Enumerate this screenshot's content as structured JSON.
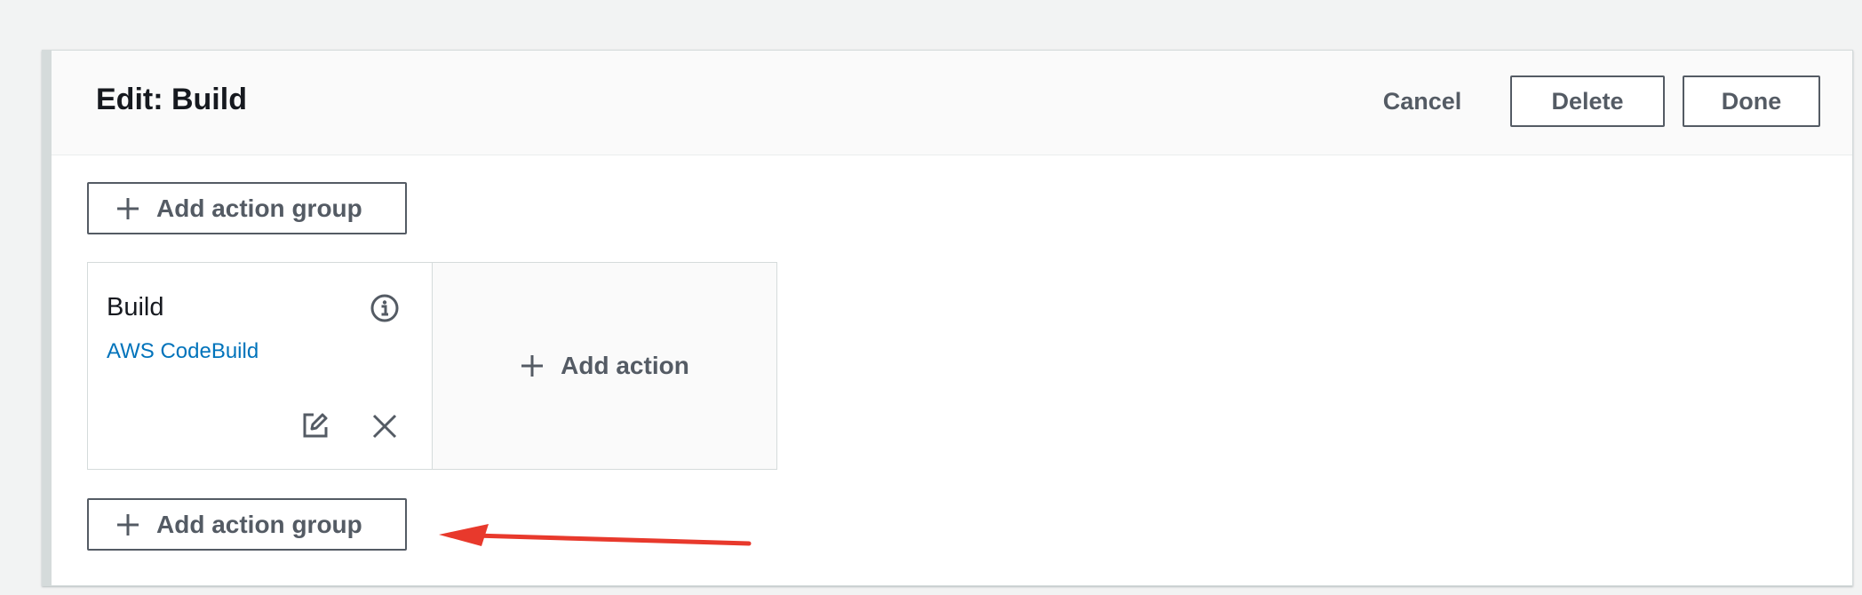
{
  "header": {
    "title": "Edit: Build",
    "cancel_label": "Cancel",
    "delete_label": "Delete",
    "done_label": "Done"
  },
  "add_action_group_top": {
    "label": "Add action group",
    "icon": "plus-icon"
  },
  "action_group": {
    "action": {
      "name": "Build",
      "provider": "AWS CodeBuild",
      "icons": [
        "info-icon",
        "edit-icon",
        "close-icon"
      ]
    },
    "add_action": {
      "label": "Add action",
      "icon": "plus-icon"
    }
  },
  "add_action_group_bottom": {
    "label": "Add action group",
    "icon": "plus-icon"
  },
  "annotation": {
    "type": "arrow",
    "color": "#e8392c"
  },
  "colors": {
    "text_secondary": "#545b64",
    "link": "#0073bb",
    "border": "#d5dbdb",
    "background": "#f2f3f3"
  }
}
